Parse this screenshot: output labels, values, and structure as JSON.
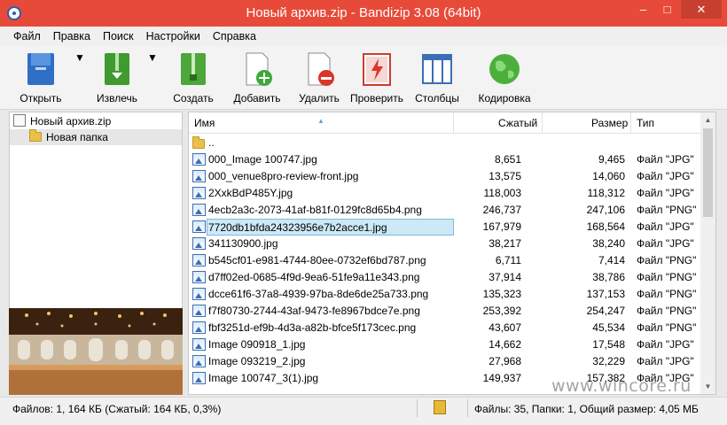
{
  "window": {
    "title": "Новый архив.zip - Bandizip 3.08 (64bit)",
    "minimize_glyph": "–",
    "maximize_glyph": "□",
    "close_glyph": "✕"
  },
  "menu": [
    "Файл",
    "Правка",
    "Поиск",
    "Настройки",
    "Справка"
  ],
  "toolbar": {
    "open": "Открыть",
    "extract": "Извлечь",
    "create": "Создать",
    "add": "Добавить",
    "delete": "Удалить",
    "test": "Проверить",
    "columns": "Столбцы",
    "codepage": "Кодировка"
  },
  "tree": {
    "root": "Новый архив.zip",
    "child": "Новая папка"
  },
  "columns": {
    "name": "Имя",
    "packed": "Сжатый",
    "size": "Размер",
    "type": "Тип"
  },
  "files": [
    {
      "name": "..",
      "packed": "",
      "size": "",
      "type": "",
      "kind": "folder-icon"
    },
    {
      "name": "000_Image 100747.jpg",
      "packed": "8,651",
      "size": "9,465",
      "type": "Файл \"JPG\"",
      "kind": "image-icon"
    },
    {
      "name": "000_venue8pro-review-front.jpg",
      "packed": "13,575",
      "size": "14,060",
      "type": "Файл \"JPG\"",
      "kind": "image-icon"
    },
    {
      "name": "2XxkBdP485Y.jpg",
      "packed": "118,003",
      "size": "118,312",
      "type": "Файл \"JPG\"",
      "kind": "image-icon"
    },
    {
      "name": "4ecb2a3c-2073-41af-b81f-0129fc8d65b4.png",
      "packed": "246,737",
      "size": "247,106",
      "type": "Файл \"PNG\"",
      "kind": "image-icon"
    },
    {
      "name": "7720db1bfda24323956e7b2acce1.jpg",
      "packed": "167,979",
      "size": "168,564",
      "type": "Файл \"JPG\"",
      "kind": "image-icon",
      "selected": true
    },
    {
      "name": "341130900.jpg",
      "packed": "38,217",
      "size": "38,240",
      "type": "Файл \"JPG\"",
      "kind": "image-icon"
    },
    {
      "name": "b545cf01-e981-4744-80ee-0732ef6bd787.png",
      "packed": "6,711",
      "size": "7,414",
      "type": "Файл \"PNG\"",
      "kind": "image-icon"
    },
    {
      "name": "d7ff02ed-0685-4f9d-9ea6-51fe9a11e343.png",
      "packed": "37,914",
      "size": "38,786",
      "type": "Файл \"PNG\"",
      "kind": "image-icon"
    },
    {
      "name": "dcce61f6-37a8-4939-97ba-8de6de25a733.png",
      "packed": "135,323",
      "size": "137,153",
      "type": "Файл \"PNG\"",
      "kind": "image-icon"
    },
    {
      "name": "f7f80730-2744-43af-9473-fe8967bdce7e.png",
      "packed": "253,392",
      "size": "254,247",
      "type": "Файл \"PNG\"",
      "kind": "image-icon"
    },
    {
      "name": "fbf3251d-ef9b-4d3a-a82b-bfce5f173cec.png",
      "packed": "43,607",
      "size": "45,534",
      "type": "Файл \"PNG\"",
      "kind": "image-icon"
    },
    {
      "name": "Image 090918_1.jpg",
      "packed": "14,662",
      "size": "17,548",
      "type": "Файл \"JPG\"",
      "kind": "image-icon"
    },
    {
      "name": "Image 093219_2.jpg",
      "packed": "27,968",
      "size": "32,229",
      "type": "Файл \"JPG\"",
      "kind": "image-icon"
    },
    {
      "name": "Image 100747_3(1).jpg",
      "packed": "149,937",
      "size": "157,382",
      "type": "Файл \"JPG\"",
      "kind": "image-icon"
    }
  ],
  "status": {
    "left": "Файлов: 1, 164 КБ (Сжатый: 164 КБ, 0,3%)",
    "right": "Файлы: 35, Папки: 1, Общий размер: 4,05 МБ"
  },
  "watermark": "www.wincore.ru",
  "colors": {
    "titlebar": "#e84a3a",
    "selection": "#cde8f7"
  }
}
